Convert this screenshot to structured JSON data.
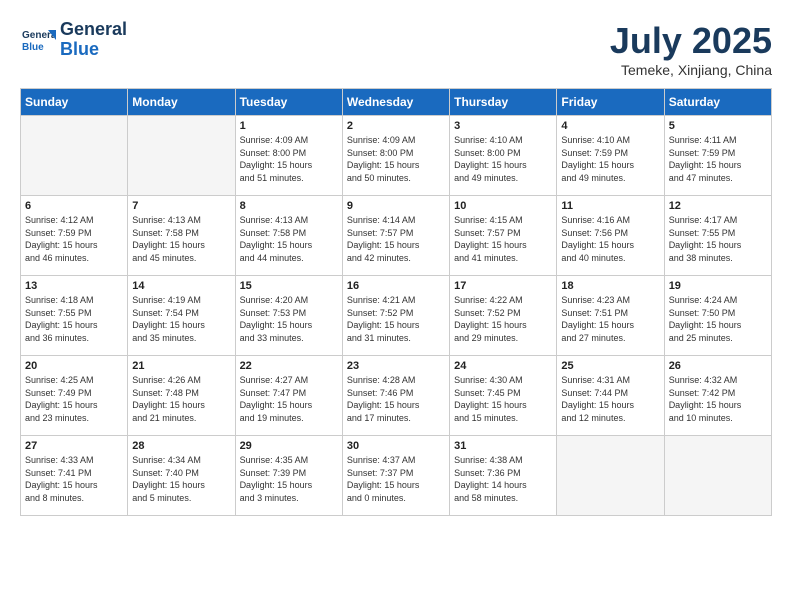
{
  "header": {
    "logo_line1": "General",
    "logo_line2": "Blue",
    "month": "July 2025",
    "location": "Temeke, Xinjiang, China"
  },
  "weekdays": [
    "Sunday",
    "Monday",
    "Tuesday",
    "Wednesday",
    "Thursday",
    "Friday",
    "Saturday"
  ],
  "weeks": [
    [
      {
        "day": "",
        "info": ""
      },
      {
        "day": "",
        "info": ""
      },
      {
        "day": "1",
        "info": "Sunrise: 4:09 AM\nSunset: 8:00 PM\nDaylight: 15 hours\nand 51 minutes."
      },
      {
        "day": "2",
        "info": "Sunrise: 4:09 AM\nSunset: 8:00 PM\nDaylight: 15 hours\nand 50 minutes."
      },
      {
        "day": "3",
        "info": "Sunrise: 4:10 AM\nSunset: 8:00 PM\nDaylight: 15 hours\nand 49 minutes."
      },
      {
        "day": "4",
        "info": "Sunrise: 4:10 AM\nSunset: 7:59 PM\nDaylight: 15 hours\nand 49 minutes."
      },
      {
        "day": "5",
        "info": "Sunrise: 4:11 AM\nSunset: 7:59 PM\nDaylight: 15 hours\nand 47 minutes."
      }
    ],
    [
      {
        "day": "6",
        "info": "Sunrise: 4:12 AM\nSunset: 7:59 PM\nDaylight: 15 hours\nand 46 minutes."
      },
      {
        "day": "7",
        "info": "Sunrise: 4:13 AM\nSunset: 7:58 PM\nDaylight: 15 hours\nand 45 minutes."
      },
      {
        "day": "8",
        "info": "Sunrise: 4:13 AM\nSunset: 7:58 PM\nDaylight: 15 hours\nand 44 minutes."
      },
      {
        "day": "9",
        "info": "Sunrise: 4:14 AM\nSunset: 7:57 PM\nDaylight: 15 hours\nand 42 minutes."
      },
      {
        "day": "10",
        "info": "Sunrise: 4:15 AM\nSunset: 7:57 PM\nDaylight: 15 hours\nand 41 minutes."
      },
      {
        "day": "11",
        "info": "Sunrise: 4:16 AM\nSunset: 7:56 PM\nDaylight: 15 hours\nand 40 minutes."
      },
      {
        "day": "12",
        "info": "Sunrise: 4:17 AM\nSunset: 7:55 PM\nDaylight: 15 hours\nand 38 minutes."
      }
    ],
    [
      {
        "day": "13",
        "info": "Sunrise: 4:18 AM\nSunset: 7:55 PM\nDaylight: 15 hours\nand 36 minutes."
      },
      {
        "day": "14",
        "info": "Sunrise: 4:19 AM\nSunset: 7:54 PM\nDaylight: 15 hours\nand 35 minutes."
      },
      {
        "day": "15",
        "info": "Sunrise: 4:20 AM\nSunset: 7:53 PM\nDaylight: 15 hours\nand 33 minutes."
      },
      {
        "day": "16",
        "info": "Sunrise: 4:21 AM\nSunset: 7:52 PM\nDaylight: 15 hours\nand 31 minutes."
      },
      {
        "day": "17",
        "info": "Sunrise: 4:22 AM\nSunset: 7:52 PM\nDaylight: 15 hours\nand 29 minutes."
      },
      {
        "day": "18",
        "info": "Sunrise: 4:23 AM\nSunset: 7:51 PM\nDaylight: 15 hours\nand 27 minutes."
      },
      {
        "day": "19",
        "info": "Sunrise: 4:24 AM\nSunset: 7:50 PM\nDaylight: 15 hours\nand 25 minutes."
      }
    ],
    [
      {
        "day": "20",
        "info": "Sunrise: 4:25 AM\nSunset: 7:49 PM\nDaylight: 15 hours\nand 23 minutes."
      },
      {
        "day": "21",
        "info": "Sunrise: 4:26 AM\nSunset: 7:48 PM\nDaylight: 15 hours\nand 21 minutes."
      },
      {
        "day": "22",
        "info": "Sunrise: 4:27 AM\nSunset: 7:47 PM\nDaylight: 15 hours\nand 19 minutes."
      },
      {
        "day": "23",
        "info": "Sunrise: 4:28 AM\nSunset: 7:46 PM\nDaylight: 15 hours\nand 17 minutes."
      },
      {
        "day": "24",
        "info": "Sunrise: 4:30 AM\nSunset: 7:45 PM\nDaylight: 15 hours\nand 15 minutes."
      },
      {
        "day": "25",
        "info": "Sunrise: 4:31 AM\nSunset: 7:44 PM\nDaylight: 15 hours\nand 12 minutes."
      },
      {
        "day": "26",
        "info": "Sunrise: 4:32 AM\nSunset: 7:42 PM\nDaylight: 15 hours\nand 10 minutes."
      }
    ],
    [
      {
        "day": "27",
        "info": "Sunrise: 4:33 AM\nSunset: 7:41 PM\nDaylight: 15 hours\nand 8 minutes."
      },
      {
        "day": "28",
        "info": "Sunrise: 4:34 AM\nSunset: 7:40 PM\nDaylight: 15 hours\nand 5 minutes."
      },
      {
        "day": "29",
        "info": "Sunrise: 4:35 AM\nSunset: 7:39 PM\nDaylight: 15 hours\nand 3 minutes."
      },
      {
        "day": "30",
        "info": "Sunrise: 4:37 AM\nSunset: 7:37 PM\nDaylight: 15 hours\nand 0 minutes."
      },
      {
        "day": "31",
        "info": "Sunrise: 4:38 AM\nSunset: 7:36 PM\nDaylight: 14 hours\nand 58 minutes."
      },
      {
        "day": "",
        "info": ""
      },
      {
        "day": "",
        "info": ""
      }
    ]
  ]
}
